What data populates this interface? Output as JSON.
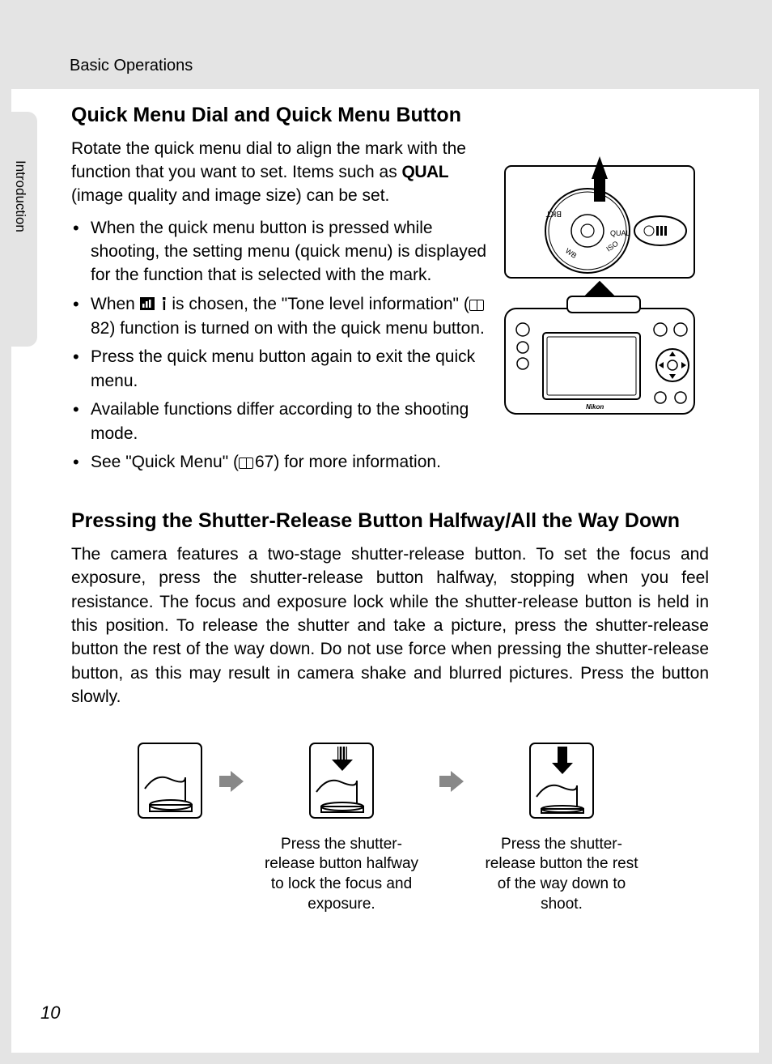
{
  "header": {
    "section_label": "Basic Operations"
  },
  "side_tab": {
    "label": "Introduction"
  },
  "section1": {
    "heading": "Quick Menu Dial and Quick Menu Button",
    "intro_prefix": "Rotate the quick menu dial to align the mark with the function that you want to set. Items such as ",
    "qual_label": "QUAL",
    "intro_suffix": " (image quality and image size) can be set.",
    "bullets": {
      "b1": "When the quick menu button is pressed while shooting, the setting menu (quick menu) is displayed for the function that is selected with the mark.",
      "b2_prefix": "When ",
      "b2_mid": " is chosen, the \"Tone level information\" (",
      "b2_ref": "82",
      "b2_suffix": ") function is turned on with the quick menu button.",
      "b3": "Press the quick menu button again to exit the quick menu.",
      "b4": "Available functions differ according to the shooting mode.",
      "b5_prefix": "See \"Quick Menu\" (",
      "b5_ref": "67",
      "b5_suffix": ") for more information."
    }
  },
  "section2": {
    "heading": "Pressing the Shutter-Release Button Halfway/All the Way Down",
    "para": "The camera features a two-stage shutter-release button. To set the focus and exposure, press the shutter-release button halfway, stopping when you feel resistance. The focus and exposure lock while the shutter-release button is held in this position. To release the shutter and take a picture, press the shutter-release button the rest of the way down. Do not use force when pressing the shutter-release button, as this may result in camera shake and blurred pictures. Press the button slowly.",
    "diag_caption_1": "Press the shutter-release button halfway to lock the focus and exposure.",
    "diag_caption_2": "Press the shutter-release button the rest of the way down to shoot."
  },
  "page_number": "10"
}
